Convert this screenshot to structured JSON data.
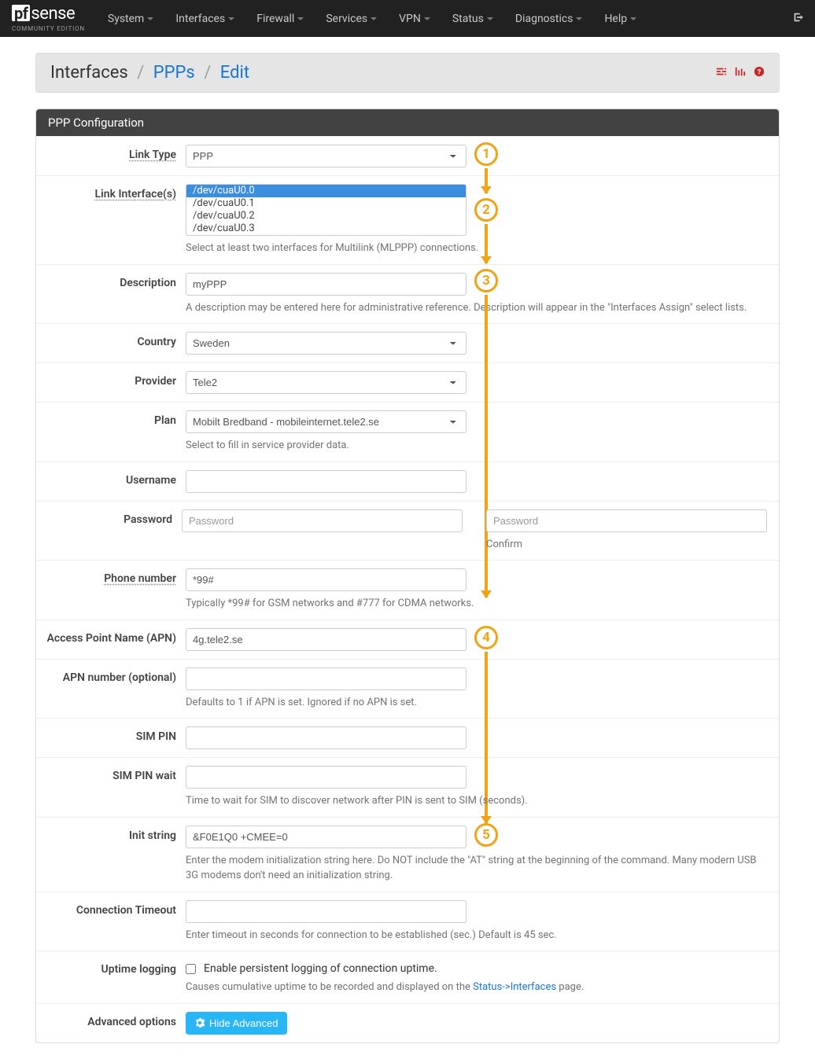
{
  "nav": {
    "brand_pf": "pf",
    "brand_sense": "sense",
    "sub": "COMMUNITY EDITION",
    "items": [
      "System",
      "Interfaces",
      "Firewall",
      "Services",
      "VPN",
      "Status",
      "Diagnostics",
      "Help"
    ]
  },
  "breadcrumb": {
    "root": "Interfaces",
    "mid": "PPPs",
    "leaf": "Edit"
  },
  "panel_title": "PPP Configuration",
  "form": {
    "link_type": {
      "label": "Link Type",
      "value": "PPP"
    },
    "link_if": {
      "label": "Link Interface(s)",
      "options": [
        "/dev/cuaU0.0",
        "/dev/cuaU0.1",
        "/dev/cuaU0.2",
        "/dev/cuaU0.3"
      ],
      "help": "Select at least two interfaces for Multilink (MLPPP) connections."
    },
    "desc": {
      "label": "Description",
      "value": "myPPP",
      "help": "A description may be entered here for administrative reference. Description will appear in the \"Interfaces Assign\" select lists."
    },
    "country": {
      "label": "Country",
      "value": "Sweden"
    },
    "provider": {
      "label": "Provider",
      "value": "Tele2"
    },
    "plan": {
      "label": "Plan",
      "value": "Mobilt Bredband - mobileinternet.tele2.se",
      "help": "Select to fill in service provider data."
    },
    "user": {
      "label": "Username",
      "value": ""
    },
    "pass": {
      "label": "Password",
      "ph": "Password",
      "confirm": "Confirm"
    },
    "phone": {
      "label": "Phone number",
      "value": "*99#",
      "help": "Typically *99# for GSM networks and #777 for CDMA networks."
    },
    "apn": {
      "label": "Access Point Name (APN)",
      "value": "4g.tele2.se"
    },
    "apnnum": {
      "label": "APN number (optional)",
      "value": "",
      "help": "Defaults to 1 if APN is set. Ignored if no APN is set."
    },
    "simpin": {
      "label": "SIM PIN",
      "value": ""
    },
    "simwait": {
      "label": "SIM PIN wait",
      "value": "",
      "help": "Time to wait for SIM to discover network after PIN is sent to SIM (seconds)."
    },
    "init": {
      "label": "Init string",
      "value": "&F0E1Q0 +CMEE=0",
      "help": "Enter the modem initialization string here. Do NOT include the \"AT\" string at the beginning of the command. Many modern USB 3G modems don't need an initialization string."
    },
    "timeout": {
      "label": "Connection Timeout",
      "value": "",
      "help": "Enter timeout in seconds for connection to be established (sec.) Default is 45 sec."
    },
    "uptime": {
      "label": "Uptime logging",
      "chk": "Enable persistent logging of connection uptime.",
      "help_a": "Causes cumulative uptime to be recorded and displayed on the ",
      "help_link": "Status->Interfaces",
      "help_b": " page."
    },
    "adv": {
      "label": "Advanced options",
      "btn": "Hide Advanced"
    }
  },
  "bubbles": {
    "b1": "1",
    "b2": "2",
    "b3": "3",
    "b4": "4",
    "b5": "5"
  }
}
